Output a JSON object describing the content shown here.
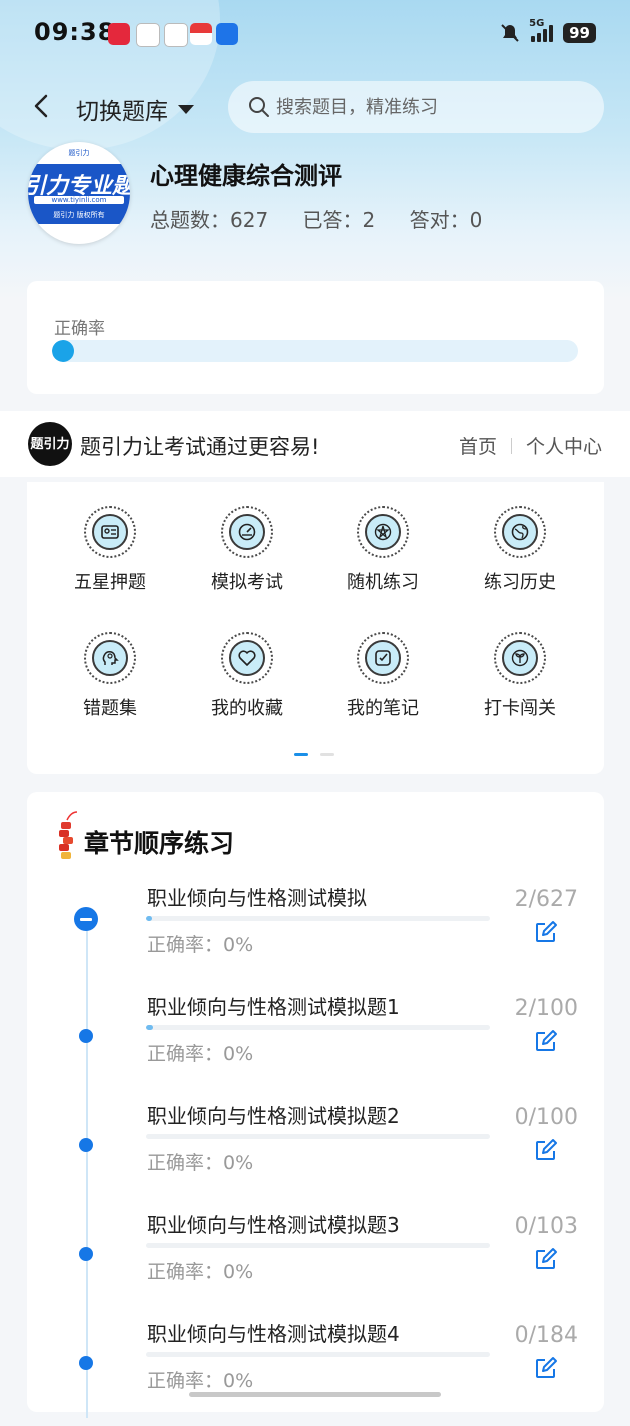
{
  "status_bar": {
    "time": "09:38",
    "network": "5G",
    "battery": "99",
    "app_icons": [
      "xiaohongshu-icon",
      "chat-icon",
      "chat-bubble-icon",
      "red-app-icon",
      "blue-app-icon"
    ]
  },
  "header": {
    "bank_label": "切换题库",
    "search_placeholder": "搜索题目，精准练习"
  },
  "profile": {
    "logo_text": "引力专业题",
    "logo_url": "www.tiyinli.com",
    "logo_caption": "题引力 版权所有",
    "logo_top": "题引力",
    "title": "心理健康综合测评",
    "total_label": "总题数：627",
    "answered_label": "已答：2",
    "correct_label": "答对：0"
  },
  "accuracy": {
    "label": "正确率",
    "value_percent": 0
  },
  "brand": {
    "logo_text": "题引力",
    "slogan": "题引力让考试通过更容易!",
    "nav_home": "首页",
    "nav_profile": "个人中心"
  },
  "menu": {
    "items": [
      {
        "label": "五星押题",
        "icon": "id-card-icon"
      },
      {
        "label": "模拟考试",
        "icon": "speedometer-icon"
      },
      {
        "label": "随机练习",
        "icon": "shuffle-star-icon"
      },
      {
        "label": "练习历史",
        "icon": "globe-icon"
      },
      {
        "label": "错题集",
        "icon": "head-icon"
      },
      {
        "label": "我的收藏",
        "icon": "heart-icon"
      },
      {
        "label": "我的笔记",
        "icon": "note-check-icon"
      },
      {
        "label": "打卡闯关",
        "icon": "sprout-icon"
      }
    ],
    "page_indicator": {
      "pages": 2,
      "current": 1
    }
  },
  "chapters": {
    "title": "章节顺序练习",
    "items": [
      {
        "name": "职业倾向与性格测试模拟",
        "accuracy": "正确率：0%",
        "count": "2/627",
        "progress": 0.003,
        "expanded": true
      },
      {
        "name": "职业倾向与性格测试模拟题1",
        "accuracy": "正确率：0%",
        "count": "2/100",
        "progress": 0.02,
        "expanded": false
      },
      {
        "name": "职业倾向与性格测试模拟题2",
        "accuracy": "正确率：0%",
        "count": "0/100",
        "progress": 0,
        "expanded": false
      },
      {
        "name": "职业倾向与性格测试模拟题3",
        "accuracy": "正确率：0%",
        "count": "0/103",
        "progress": 0,
        "expanded": false
      },
      {
        "name": "职业倾向与性格测试模拟题4",
        "accuracy": "正确率：0%",
        "count": "0/184",
        "progress": 0,
        "expanded": false
      }
    ]
  },
  "colors": {
    "accent": "#1677e6",
    "accuracy_fill": "#1aa3e8",
    "track": "#e3f2fb"
  }
}
